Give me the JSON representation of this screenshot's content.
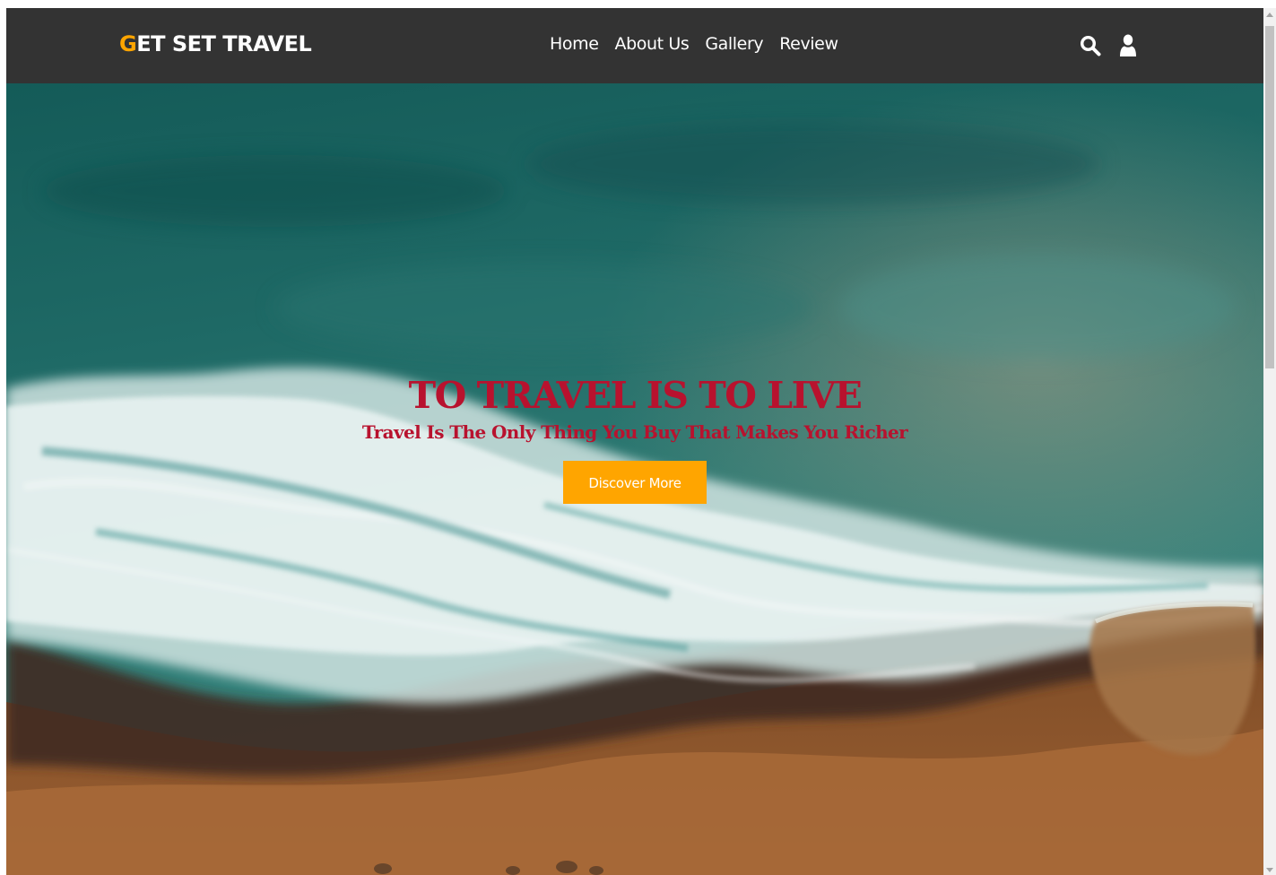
{
  "header": {
    "logo_first_letter": "G",
    "logo_rest": "ET SET TRAVEL",
    "nav": [
      {
        "label": "Home"
      },
      {
        "label": "About Us"
      },
      {
        "label": "Gallery"
      },
      {
        "label": "Review"
      }
    ],
    "icons": [
      "search-icon",
      "user-icon"
    ]
  },
  "hero": {
    "title": "TO TRAVEL IS TO LIVE",
    "subtitle": "Travel Is The Only Thing You Buy That Makes You Richer",
    "button_label": "Discover More"
  },
  "colors": {
    "navbar_bg": "#333333",
    "accent": "#ffa500",
    "hero_text": "#b8122e",
    "nav_text": "#ffffff"
  }
}
